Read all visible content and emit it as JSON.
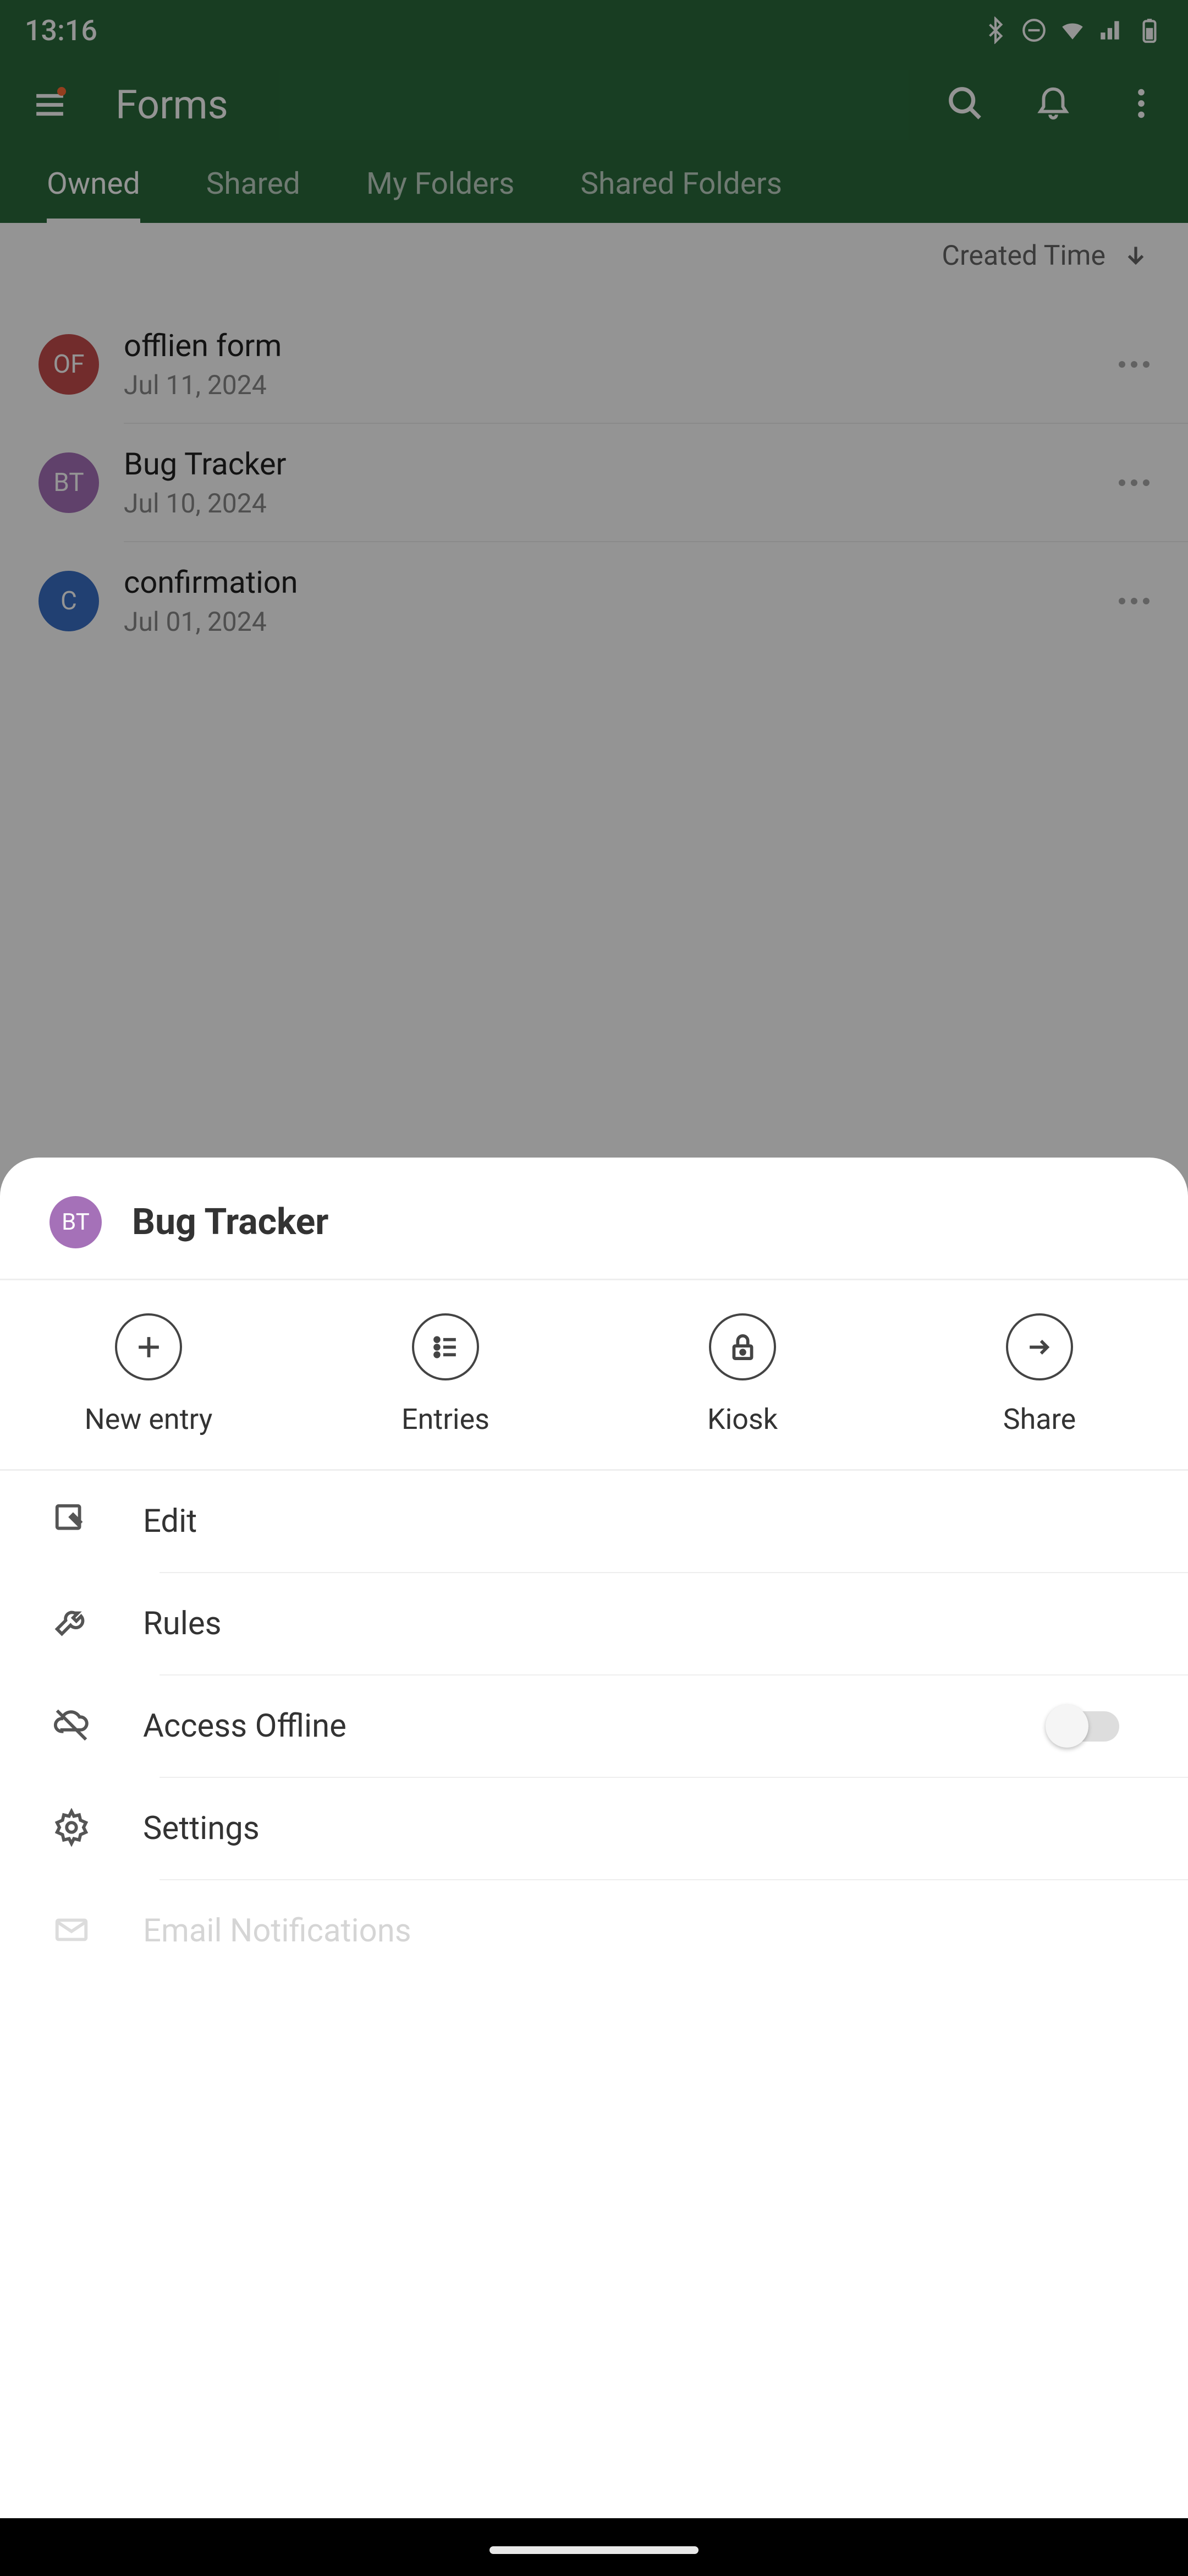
{
  "status": {
    "time": "13:16"
  },
  "toolbar": {
    "title": "Forms"
  },
  "tabs": [
    "Owned",
    "Shared",
    "My Folders",
    "Shared Folders"
  ],
  "sort": {
    "label": "Created Time"
  },
  "forms": [
    {
      "initials": "OF",
      "color": "#c44d4d",
      "name": "offlien form",
      "date": "Jul 11, 2024"
    },
    {
      "initials": "BT",
      "color": "#a571b8",
      "name": "Bug Tracker",
      "date": "Jul 10, 2024"
    },
    {
      "initials": "C",
      "color": "#3a6fc4",
      "name": "confirmation",
      "date": "Jul 01, 2024"
    }
  ],
  "sheet": {
    "avatar_initials": "BT",
    "title": "Bug Tracker",
    "actions": {
      "new_entry": "New entry",
      "entries": "Entries",
      "kiosk": "Kiosk",
      "share": "Share"
    },
    "items": {
      "edit": "Edit",
      "rules": "Rules",
      "access_offline": "Access Offline",
      "settings": "Settings",
      "email_notifications": "Email Notifications"
    },
    "toggles": {
      "access_offline": false
    }
  }
}
